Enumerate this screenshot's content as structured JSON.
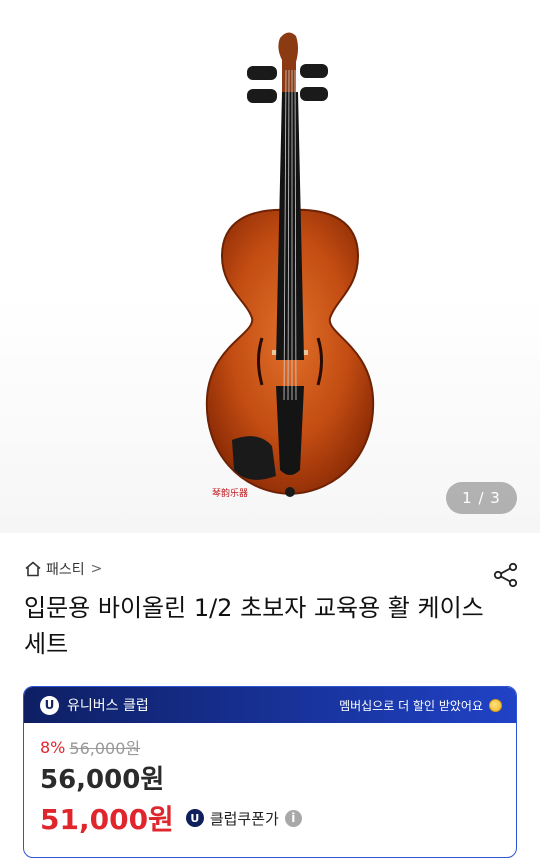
{
  "gallery": {
    "counter": "1 / 3",
    "watermark": "琴韵乐器"
  },
  "breadcrumb": {
    "home_icon": "home-icon",
    "label": "패스티",
    "chevron": ">"
  },
  "share_icon": "share-icon",
  "product": {
    "title": "입문용 바이올린 1/2 초보자 교육용 활 케이스 세트"
  },
  "club": {
    "badge": "U",
    "name": "유니버스 클럽",
    "promo": "멤버십으로 더 할인 받았어요",
    "promo_icon": "coin-icon",
    "discount_rate": "8%",
    "original_price": "56,000원",
    "base_price": "56,000원",
    "coupon_price": "51,000원",
    "coupon_badge": "U",
    "coupon_label": "클럽쿠폰가",
    "info_icon": "i"
  },
  "colors": {
    "accent_red": "#e0262d",
    "club_navy": "#0e1f63",
    "club_blue": "#2042c6"
  }
}
